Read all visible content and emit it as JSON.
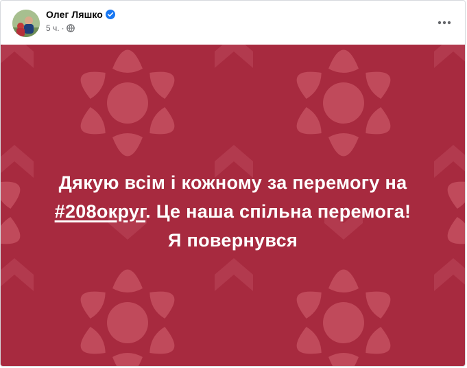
{
  "post": {
    "author_name": "Олег Ляшко",
    "verified": true,
    "timestamp": "5 ч.",
    "separator": "·",
    "privacy_icon": "globe-icon",
    "more_icon": "more-dots-icon"
  },
  "image": {
    "background_color": "#a72a3f",
    "pattern_color": "#c04a5b",
    "text_line1": "Дякую всім і кожному за перемогу на",
    "hashtag": "#208округ",
    "text_line2_rest": ". Це наша спільна перемога!",
    "text_line3": "Я повернувся"
  }
}
